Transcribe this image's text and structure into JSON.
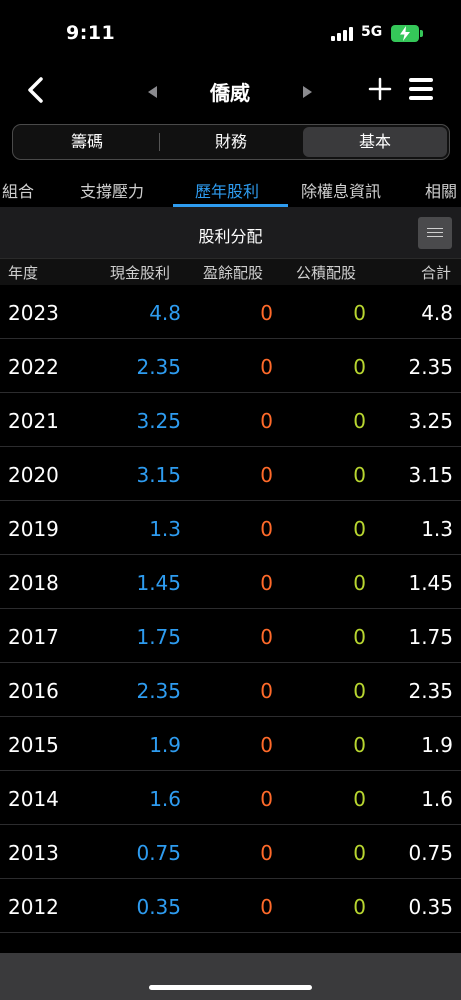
{
  "status_bar": {
    "time": "9:11",
    "network": "5G"
  },
  "nav": {
    "title": "僑威"
  },
  "segments": [
    {
      "label": "籌碼",
      "active": false
    },
    {
      "label": "財務",
      "active": false
    },
    {
      "label": "基本",
      "active": true
    }
  ],
  "tabs": [
    {
      "label": "組合",
      "active": false
    },
    {
      "label": "支撐壓力",
      "active": false
    },
    {
      "label": "歷年股利",
      "active": true
    },
    {
      "label": "除權息資訊",
      "active": false
    },
    {
      "label": "相關",
      "active": false
    }
  ],
  "section": {
    "title": "股利分配"
  },
  "table": {
    "headers": [
      "年度",
      "現金股利",
      "盈餘配股",
      "公積配股",
      "合計"
    ],
    "rows": [
      [
        "2023",
        "4.8",
        "0",
        "0",
        "4.8"
      ],
      [
        "2022",
        "2.35",
        "0",
        "0",
        "2.35"
      ],
      [
        "2021",
        "3.25",
        "0",
        "0",
        "3.25"
      ],
      [
        "2020",
        "3.15",
        "0",
        "0",
        "3.15"
      ],
      [
        "2019",
        "1.3",
        "0",
        "0",
        "1.3"
      ],
      [
        "2018",
        "1.45",
        "0",
        "0",
        "1.45"
      ],
      [
        "2017",
        "1.75",
        "0",
        "0",
        "1.75"
      ],
      [
        "2016",
        "2.35",
        "0",
        "0",
        "2.35"
      ],
      [
        "2015",
        "1.9",
        "0",
        "0",
        "1.9"
      ],
      [
        "2014",
        "1.6",
        "0",
        "0",
        "1.6"
      ],
      [
        "2013",
        "0.75",
        "0",
        "0",
        "0.75"
      ],
      [
        "2012",
        "0.35",
        "0",
        "0",
        "0.35"
      ]
    ]
  },
  "colors": {
    "accent": "#2e9cf0",
    "cash_dividend": "#2e9cf0",
    "earnings_stock": "#ff6a2a",
    "capital_stock": "#b8d630",
    "battery": "#35c759"
  },
  "icons": [
    "signal-icon",
    "battery-charging-icon",
    "back-icon",
    "prev-icon",
    "next-icon",
    "plus-icon",
    "menu-icon",
    "list-icon"
  ]
}
